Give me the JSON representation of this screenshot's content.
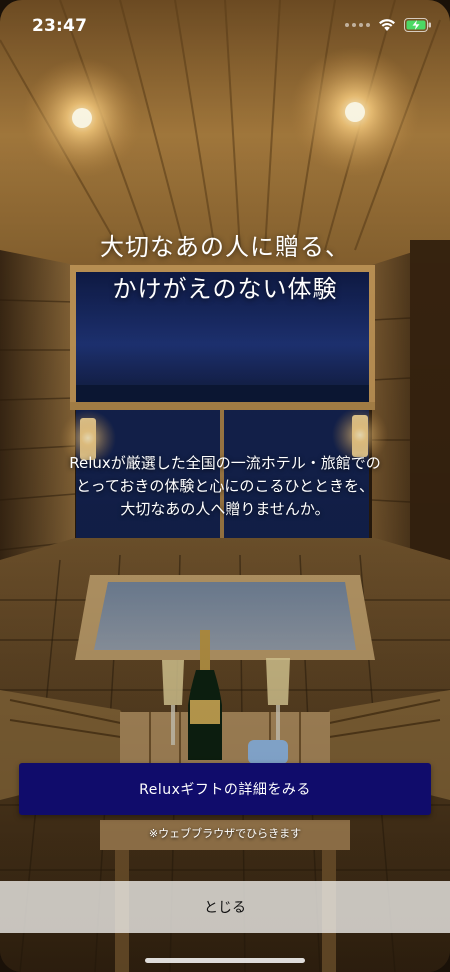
{
  "status_bar": {
    "time": "23:47"
  },
  "headline": {
    "line1": "大切なあの人に贈る、",
    "line2": "かけがえのない体験"
  },
  "description": {
    "line1": "Reluxが厳選した全国の一流ホテル・旅館での",
    "line2": "とっておきの体験と心にのこるひとときを、",
    "line3": "大切なあの人へ贈りませんか。"
  },
  "detail_button": {
    "label": "Reluxギフトの詳細をみる"
  },
  "browser_note": "※ウェブブラウザでひらきます",
  "close_button": {
    "label": "とじる"
  },
  "colors": {
    "button_bg": "#100c6b",
    "close_bar_bg": "#eeece8"
  },
  "icons": [
    "wifi-icon",
    "battery-charging-icon"
  ]
}
